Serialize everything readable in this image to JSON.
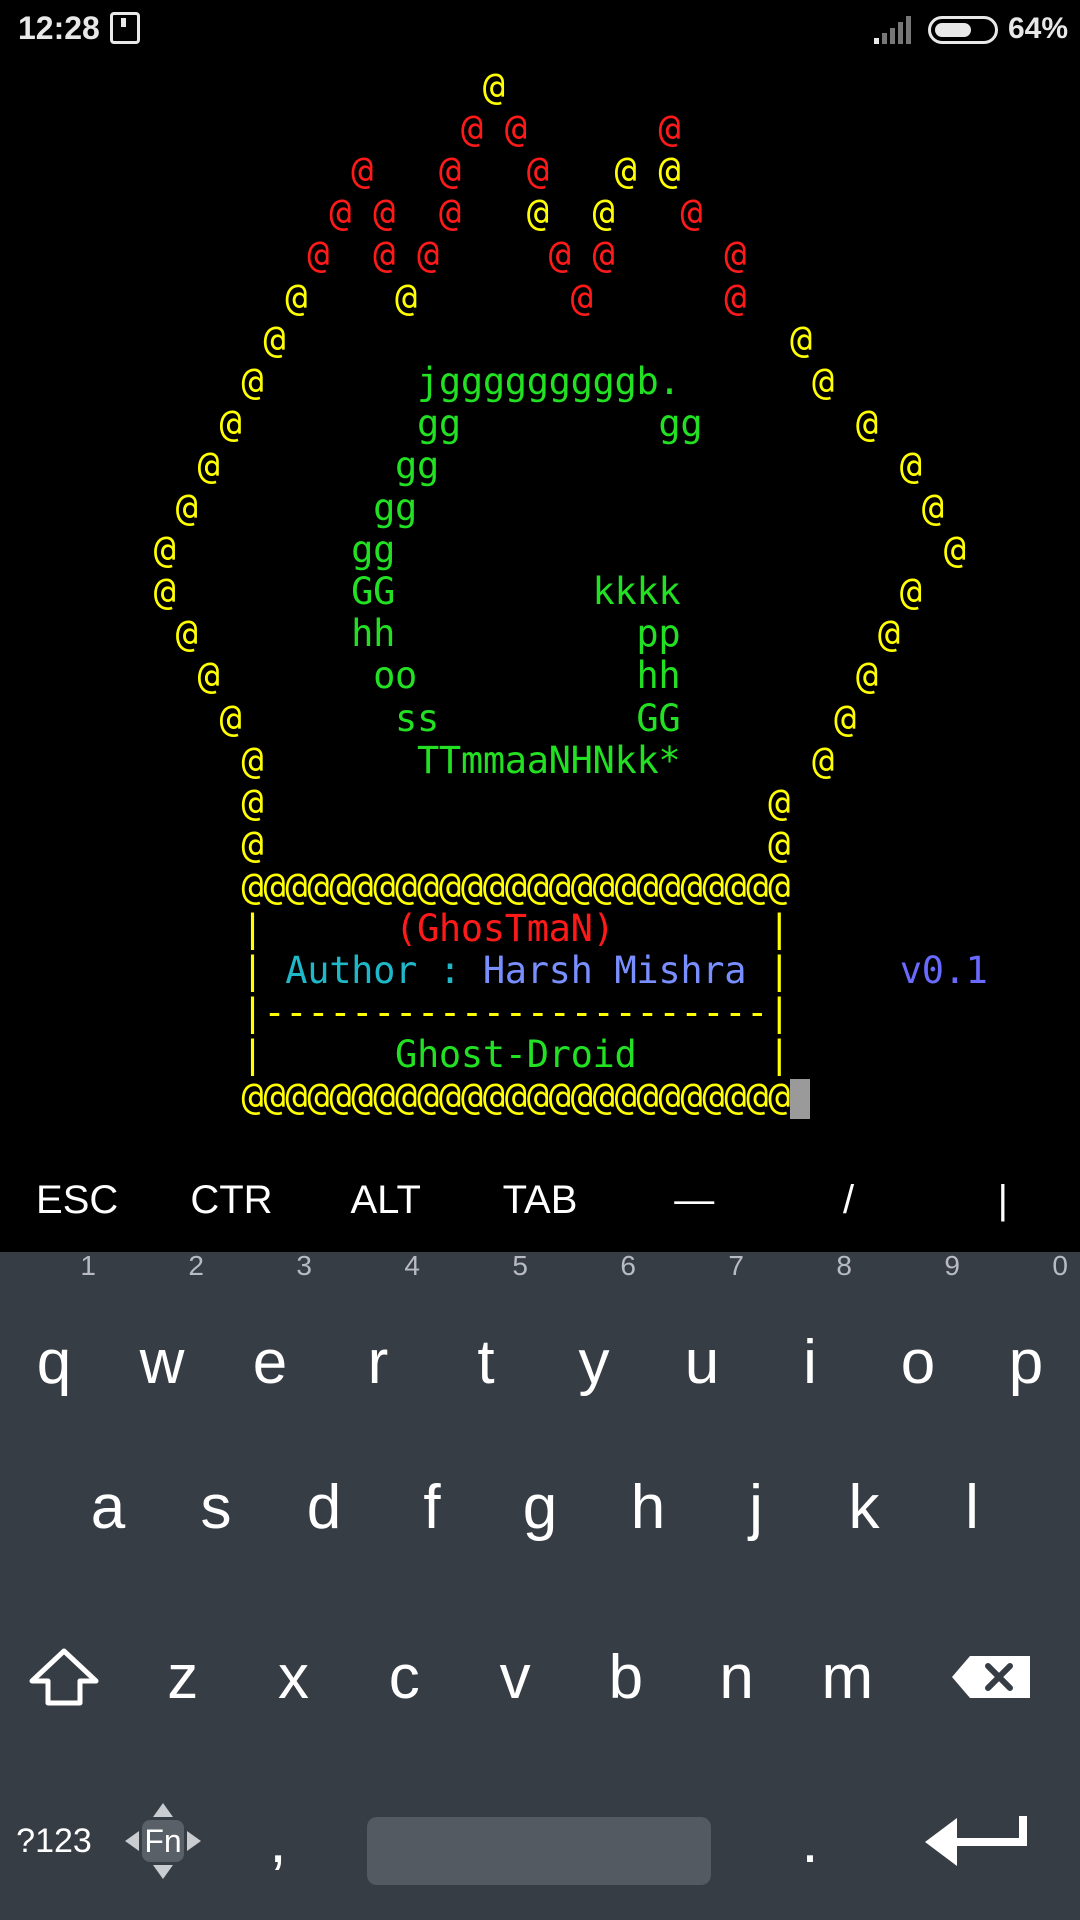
{
  "status_bar": {
    "time": "12:28",
    "battery_percent": "64%",
    "battery_level": 0.64
  },
  "colors": {
    "yellow": "#ffff00",
    "red": "#ff1a1a",
    "green": "#22e022",
    "cyan": "#1fb8c8",
    "blue": "#7a8fff",
    "violet": "#6a6aff"
  },
  "terminal": {
    "lines": [
      {
        "segments": [
          {
            "text": "                      @",
            "color": "yellow"
          }
        ]
      },
      {
        "segments": [
          {
            "text": "                     @ @",
            "color": "red"
          },
          {
            "text": "      @",
            "color": "red"
          }
        ]
      },
      {
        "segments": [
          {
            "text": "                @   @   ",
            "color": "red"
          },
          {
            "text": "@",
            "color": "red"
          },
          {
            "text": "   @ @",
            "color": "yellow"
          }
        ]
      },
      {
        "segments": [
          {
            "text": "               @ @  @   ",
            "color": "red"
          },
          {
            "text": "@  @",
            "color": "yellow"
          },
          {
            "text": "   @",
            "color": "red"
          }
        ]
      },
      {
        "segments": [
          {
            "text": "              @  @ @     @ @     @",
            "color": "red"
          }
        ]
      },
      {
        "segments": [
          {
            "text": "             @    @",
            "color": "yellow"
          },
          {
            "text": "       @      @",
            "color": "red"
          }
        ]
      },
      {
        "segments": [
          {
            "text": "            @                       @",
            "color": "yellow"
          }
        ]
      },
      {
        "segments": [
          {
            "text": "           @",
            "color": "yellow"
          },
          {
            "text": "       jgggggggggb.",
            "color": "green"
          },
          {
            "text": "      @",
            "color": "yellow"
          }
        ]
      },
      {
        "segments": [
          {
            "text": "          @",
            "color": "yellow"
          },
          {
            "text": "        gg         gg",
            "color": "green"
          },
          {
            "text": "       @",
            "color": "yellow"
          }
        ]
      },
      {
        "segments": [
          {
            "text": "         @",
            "color": "yellow"
          },
          {
            "text": "        gg",
            "color": "green"
          },
          {
            "text": "                     @",
            "color": "yellow"
          }
        ]
      },
      {
        "segments": [
          {
            "text": "        @",
            "color": "yellow"
          },
          {
            "text": "        gg",
            "color": "green"
          },
          {
            "text": "                       @",
            "color": "yellow"
          }
        ]
      },
      {
        "segments": [
          {
            "text": "       @",
            "color": "yellow"
          },
          {
            "text": "        gg",
            "color": "green"
          },
          {
            "text": "                         @",
            "color": "yellow"
          }
        ]
      },
      {
        "segments": [
          {
            "text": "       @",
            "color": "yellow"
          },
          {
            "text": "        GG         kkkk",
            "color": "green"
          },
          {
            "text": "          @",
            "color": "yellow"
          }
        ]
      },
      {
        "segments": [
          {
            "text": "        @",
            "color": "yellow"
          },
          {
            "text": "       hh           pp",
            "color": "green"
          },
          {
            "text": "         @",
            "color": "yellow"
          }
        ]
      },
      {
        "segments": [
          {
            "text": "         @",
            "color": "yellow"
          },
          {
            "text": "       oo          hh",
            "color": "green"
          },
          {
            "text": "        @",
            "color": "yellow"
          }
        ]
      },
      {
        "segments": [
          {
            "text": "          @",
            "color": "yellow"
          },
          {
            "text": "       ss         GG",
            "color": "green"
          },
          {
            "text": "       @",
            "color": "yellow"
          }
        ]
      },
      {
        "segments": [
          {
            "text": "           @",
            "color": "yellow"
          },
          {
            "text": "       TTmmaaNHNkk*",
            "color": "green"
          },
          {
            "text": "      @",
            "color": "yellow"
          }
        ]
      },
      {
        "segments": [
          {
            "text": "           @                       @",
            "color": "yellow"
          }
        ]
      },
      {
        "segments": [
          {
            "text": "           @                       @",
            "color": "yellow"
          }
        ]
      },
      {
        "segments": [
          {
            "text": "           @@@@@@@@@@@@@@@@@@@@@@@@@",
            "color": "yellow"
          }
        ]
      },
      {
        "segments": [
          {
            "text": "           |      ",
            "color": "yellow"
          },
          {
            "text": "(GhosTmaN)",
            "color": "red"
          },
          {
            "text": "       |",
            "color": "yellow"
          }
        ]
      },
      {
        "segments": [
          {
            "text": "           | ",
            "color": "yellow"
          },
          {
            "text": "Author : ",
            "color": "cyan"
          },
          {
            "text": "Harsh Mishra",
            "color": "blue"
          },
          {
            "text": " |",
            "color": "yellow"
          },
          {
            "text": "     v0.1",
            "color": "violet"
          }
        ]
      },
      {
        "segments": [
          {
            "text": "           |-----------------------|",
            "color": "yellow"
          }
        ]
      },
      {
        "segments": [
          {
            "text": "           |      ",
            "color": "yellow"
          },
          {
            "text": "Ghost-Droid",
            "color": "green"
          },
          {
            "text": "      |",
            "color": "yellow"
          }
        ]
      },
      {
        "segments": [
          {
            "text": "           @@@@@@@@@@@@@@@@@@@@@@@@@",
            "color": "yellow"
          }
        ]
      }
    ]
  },
  "extra_keys": [
    "ESC",
    "CTR",
    "ALT",
    "TAB",
    "—",
    "/",
    "|"
  ],
  "keyboard": {
    "row1": [
      {
        "label": "q",
        "hint": "1"
      },
      {
        "label": "w",
        "hint": "2"
      },
      {
        "label": "e",
        "hint": "3"
      },
      {
        "label": "r",
        "hint": "4"
      },
      {
        "label": "t",
        "hint": "5"
      },
      {
        "label": "y",
        "hint": "6"
      },
      {
        "label": "u",
        "hint": "7"
      },
      {
        "label": "i",
        "hint": "8"
      },
      {
        "label": "o",
        "hint": "9"
      },
      {
        "label": "p",
        "hint": "0"
      }
    ],
    "row2": [
      "a",
      "s",
      "d",
      "f",
      "g",
      "h",
      "j",
      "k",
      "l"
    ],
    "row3": [
      "z",
      "x",
      "c",
      "v",
      "b",
      "n",
      "m"
    ],
    "symbols_label": "?123",
    "fn_label": "Fn",
    "comma": ",",
    "period": "."
  }
}
